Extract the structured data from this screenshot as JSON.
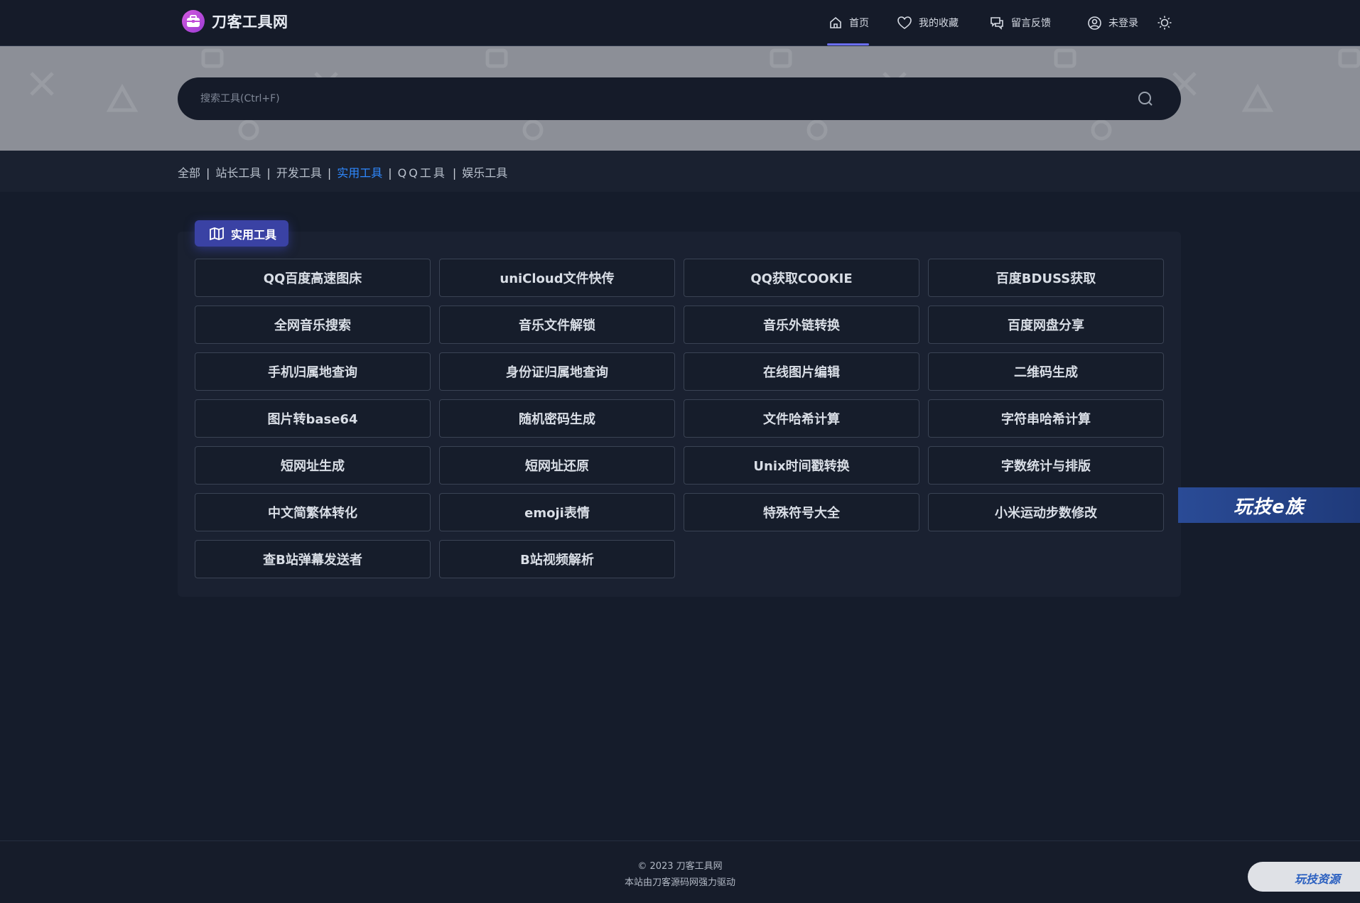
{
  "header": {
    "logo_text": "刀客工具网",
    "nav": {
      "home": "首页",
      "favorites": "我的收藏",
      "feedback": "留言反馈",
      "login": "未登录"
    }
  },
  "search": {
    "placeholder": "搜索工具(Ctrl+F)",
    "value": ""
  },
  "categories": [
    "全部",
    "站长工具",
    "开发工具",
    "实用工具",
    "QQ工具",
    "娱乐工具"
  ],
  "active_category": "实用工具",
  "panel": {
    "title": "实用工具",
    "tools": [
      "QQ百度高速图床",
      "uniCloud文件快传",
      "QQ获取COOKIE",
      "百度BDUSS获取",
      "全网音乐搜索",
      "音乐文件解锁",
      "音乐外链转换",
      "百度网盘分享",
      "手机归属地查询",
      "身份证归属地查询",
      "在线图片编辑",
      "二维码生成",
      "图片转base64",
      "随机密码生成",
      "文件哈希计算",
      "字符串哈希计算",
      "短网址生成",
      "短网址还原",
      "Unix时间戳转换",
      "字数统计与排版",
      "中文简繁体转化",
      "emoji表情",
      "特殊符号大全",
      "小米运动步数修改",
      "查B站弹幕发送者",
      "B站视频解析"
    ]
  },
  "side_ad": {
    "text": "玩技e族"
  },
  "footer": {
    "copyright": "© 2023 刀客工具网",
    "powered": "本站由刀客源码网强力驱动"
  },
  "corner_badge": {
    "text": "玩技资源"
  },
  "colors": {
    "accent": "#2f89ff",
    "nav_indicator": "#6b6ef0",
    "badge": "#3a42a4"
  }
}
